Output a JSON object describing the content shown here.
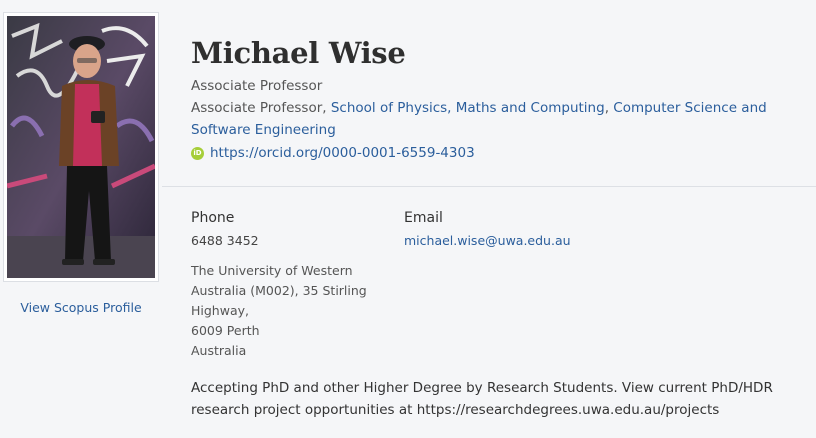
{
  "profile": {
    "name": "Michael Wise",
    "position": "Associate Professor",
    "affiliation_prefix": "Associate Professor, ",
    "school_link": "School of Physics, Maths and Computing",
    "separator": ", ",
    "dept_link": "Computer Science and Software Engineering",
    "orcid_icon_label": "iD",
    "orcid_url": "https://orcid.org/0000-0001-6559-4303",
    "photo_alt": "Photo of Michael Wise"
  },
  "sidebar": {
    "scopus_link": "View Scopus Profile"
  },
  "contact": {
    "phone_label": "Phone",
    "phone_value": "6488 3452",
    "email_label": "Email",
    "email_value": "michael.wise@uwa.edu.au",
    "address_lines": [
      "The University of Western",
      "Australia (M002), 35 Stirling",
      "Highway,",
      "6009 Perth",
      "Australia"
    ]
  },
  "notice": {
    "text": "Accepting PhD and other Higher Degree by Research Students. View current PhD/HDR research project opportunities at https://researchdegrees.uwa.edu.au/projects"
  },
  "colors": {
    "link": "#2b5e9c",
    "orcid": "#a6ce39",
    "background": "#f5f6f8"
  }
}
